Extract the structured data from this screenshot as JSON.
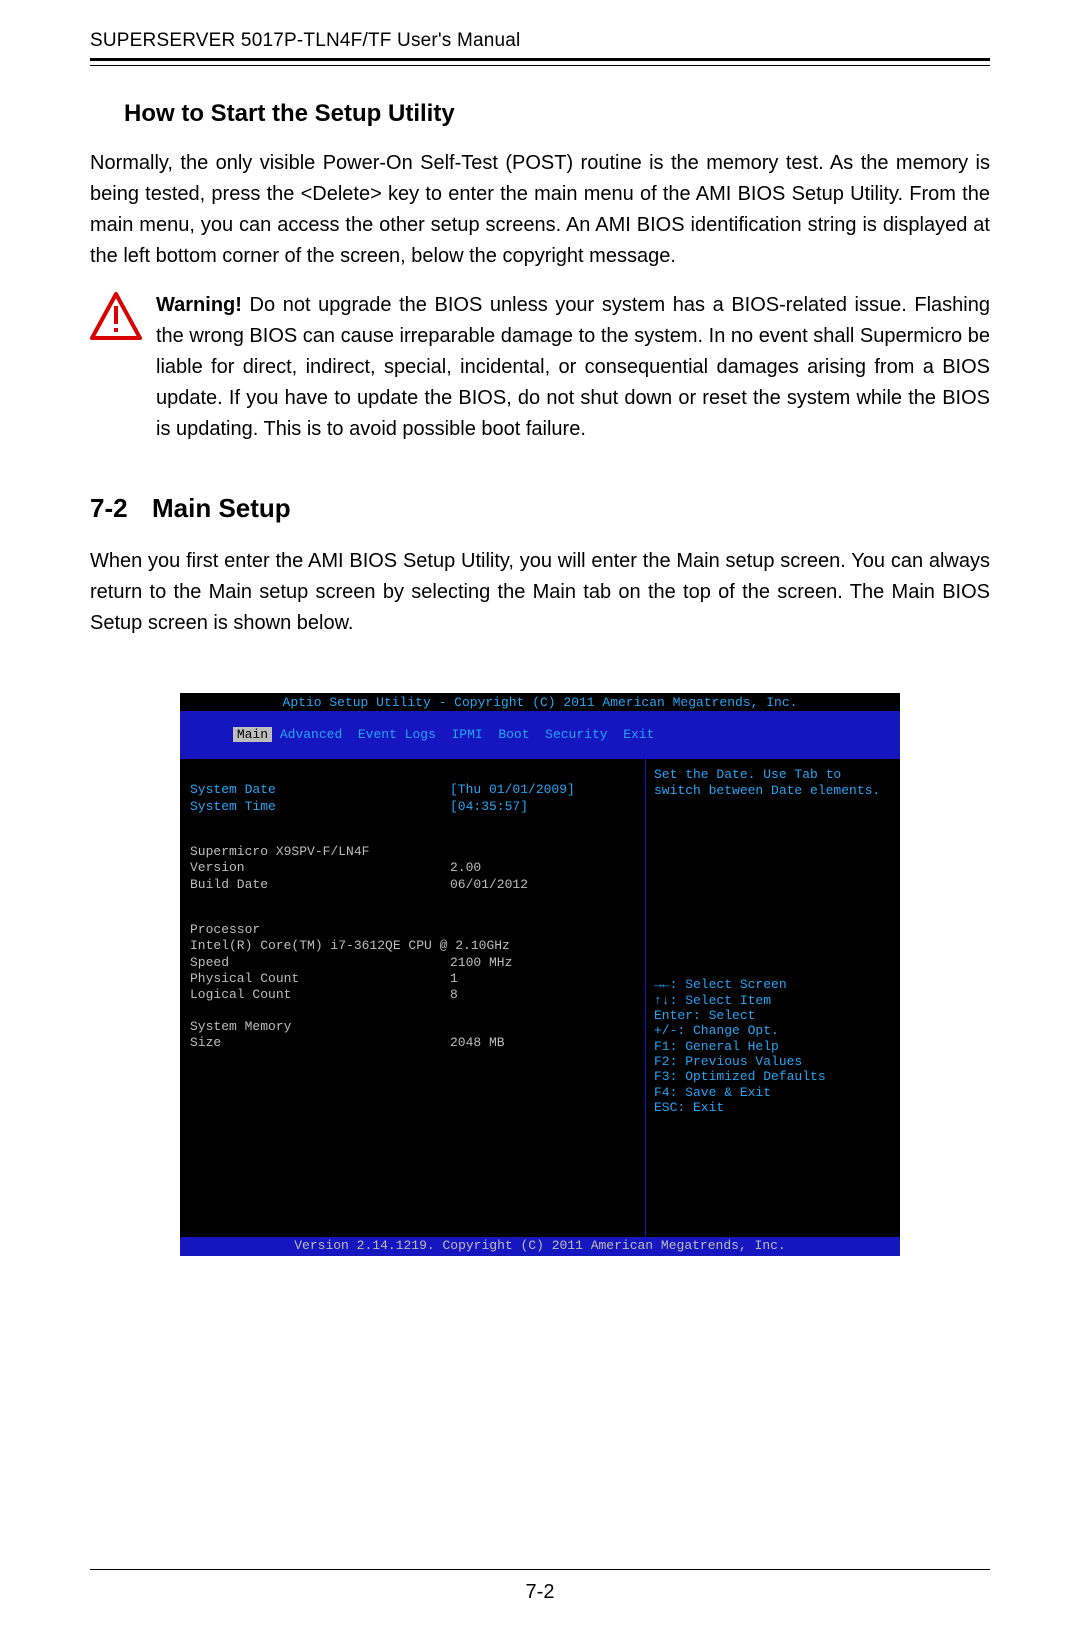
{
  "running_head": "SUPERSERVER 5017P-TLN4F/TF User's Manual",
  "section_heading": "How to Start the Setup Utility",
  "intro_paragraph": "Normally, the only visible Power-On Self-Test (POST) routine is the memory test. As the memory is being tested, press the <Delete> key to enter the main menu of the AMI BIOS Setup Utility. From the main menu, you can access the other setup screens. An AMI BIOS identification string is displayed at the left bottom corner of the screen, below the copyright message.",
  "warning_label": "Warning!",
  "warning_text": " Do not upgrade the BIOS unless your system has a BIOS-related issue. Flashing the wrong BIOS can cause irreparable damage to the system. In no event shall Supermicro be liable for direct, indirect, special, incidental, or consequential damages arising from a BIOS update. If you have to update the BIOS, do not shut down or reset the system while the BIOS is updating. This is to avoid possible boot failure.",
  "chapter_num": "7-2",
  "chapter_title": "Main Setup",
  "main_setup_paragraph": "When you first enter the AMI BIOS Setup Utility, you will enter the Main setup screen. You can always return to the Main setup screen by selecting the Main tab on the top of the screen. The Main BIOS Setup screen is shown below.",
  "page_number": "7-2",
  "bios": {
    "title": "Aptio Setup Utility - Copyright (C) 2011 American Megatrends, Inc.",
    "tabs": [
      "Main",
      "Advanced",
      "Event Logs",
      "IPMI",
      "Boot",
      "Security",
      "Exit"
    ],
    "selected_tab_index": 0,
    "hint_line1": "Set the Date. Use Tab to",
    "hint_line2": "switch between Date elements.",
    "system_date_label": "System Date",
    "system_date_value": "[Thu 01/01/2009]",
    "system_time_label": "System Time",
    "system_time_value": "[04:35:57]",
    "board": "Supermicro X9SPV-F/LN4F",
    "version_label": "Version",
    "version_value": "2.00",
    "build_label": "Build Date",
    "build_value": "06/01/2012",
    "processor_label": "Processor",
    "processor_name": "Intel(R) Core(TM) i7-3612QE CPU @ 2.10GHz",
    "speed_label": "Speed",
    "speed_value": "2100 MHz",
    "phys_label": "Physical Count",
    "phys_value": "1",
    "logical_label": "Logical Count",
    "logical_value": "8",
    "mem_label": "System Memory",
    "size_label": "Size",
    "size_value": "2048 MB",
    "keys": [
      "→←: Select Screen",
      "↑↓: Select Item",
      "Enter: Select",
      "+/-: Change Opt.",
      "F1: General Help",
      "F2: Previous Values",
      "F3: Optimized Defaults",
      "F4: Save & Exit",
      "ESC: Exit"
    ],
    "footer": "Version 2.14.1219. Copyright (C) 2011 American Megatrends, Inc."
  }
}
